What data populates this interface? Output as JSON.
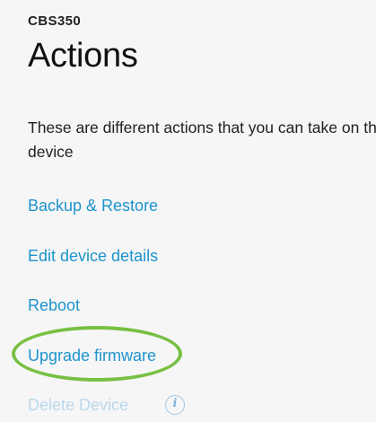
{
  "header": {
    "device_name": "CBS350",
    "title": "Actions"
  },
  "description": "These are different actions that you can take on the device",
  "actions": [
    {
      "label": "Backup & Restore",
      "enabled": true
    },
    {
      "label": "Edit device details",
      "enabled": true
    },
    {
      "label": "Reboot",
      "enabled": true
    },
    {
      "label": "Upgrade firmware",
      "enabled": true,
      "highlighted": true
    },
    {
      "label": "Delete Device",
      "enabled": false
    }
  ],
  "icons": {
    "delete_info": "info-icon"
  },
  "colors": {
    "link": "#1e93cc",
    "disabled_link": "#bad8ea",
    "highlight_ring": "#78c043"
  }
}
